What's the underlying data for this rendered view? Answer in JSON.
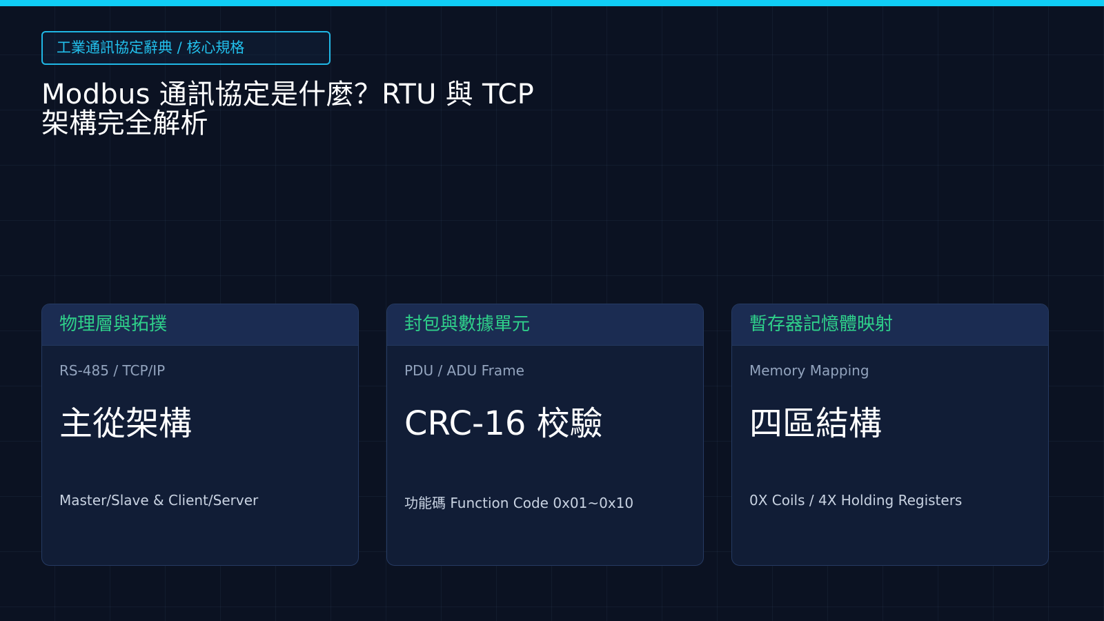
{
  "theme": {
    "accent": "#10cdf5",
    "background": "#0b1222",
    "card_background": "#111d36",
    "card_header_background": "#1b2c52",
    "card_header_text": "#2fd08a",
    "title_text": "#ffffff"
  },
  "badge": {
    "label": "工業通訊協定辭典 / 核心規格"
  },
  "title": {
    "text": "Modbus 通訊協定是什麼？RTU 與 TCP 架構完全解析"
  },
  "cards": [
    {
      "header": "物理層與拓撲",
      "subtitle": "RS-485 / TCP/IP",
      "main": "主從架構",
      "footer": "Master/Slave & Client/Server"
    },
    {
      "header": "封包與數據單元",
      "subtitle": "PDU / ADU Frame",
      "main": "CRC-16 校驗",
      "footer": "功能碼 Function Code 0x01~0x10"
    },
    {
      "header": "暫存器記憶體映射",
      "subtitle": "Memory Mapping",
      "main": "四區結構",
      "footer": "0X Coils / 4X Holding Registers"
    }
  ]
}
